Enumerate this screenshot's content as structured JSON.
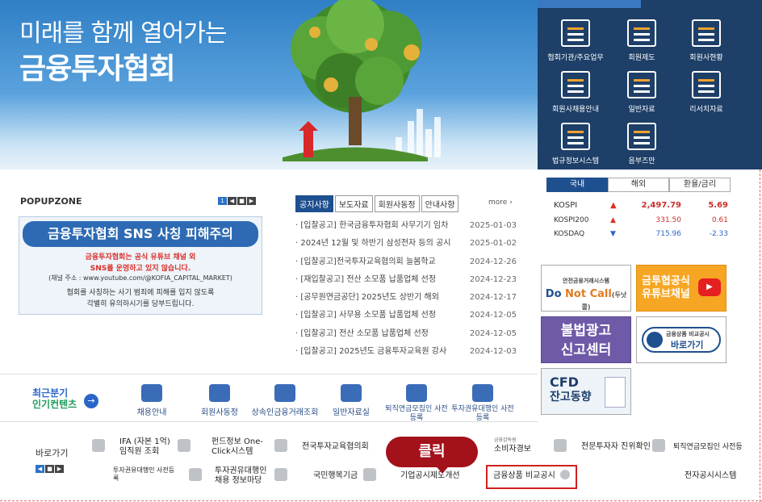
{
  "hero": {
    "subtitle": "미래를 함께 열어가는",
    "title": "금융투자협회"
  },
  "quick_menu": [
    {
      "label": "협회기관/주요업무",
      "icon": "building-icon"
    },
    {
      "label": "회원제도",
      "icon": "magnifier-icon"
    },
    {
      "label": "회원사현황",
      "icon": "basket-icon"
    },
    {
      "label": "회원사채용안내",
      "icon": "coffee-icon"
    },
    {
      "label": "일반자료",
      "icon": "document-icon"
    },
    {
      "label": "리서치자료",
      "icon": "tablet-icon"
    },
    {
      "label": "법규정보시스템",
      "icon": "ie-icon"
    },
    {
      "label": "음부즈만",
      "icon": "calculator-icon"
    }
  ],
  "popup": {
    "label": "POPUPZONE",
    "pager": [
      "1",
      "◀",
      "■",
      "▶"
    ],
    "banner_title": "금융투자협회 SNS 사칭 피해주의",
    "line1": "금융투자협회는 공식 유튜브 채널 외",
    "line2": "SNS를 운영하고 있지 않습니다.",
    "line3": "(채널 주소 : www.youtube.com/@KOFIA_CAPITAL_MARKET)",
    "line4": "협회를 사칭하는 사기 범죄에 피해를 입지 않도록",
    "line5": "각별히 유의하시기를 당부드립니다."
  },
  "notice": {
    "tabs": [
      "공지사항",
      "보도자료",
      "회원사동정",
      "안내사항"
    ],
    "more": "more",
    "items": [
      {
        "title": "[입찰공고] 한국금융투자협회 사무기기 임차",
        "date": "2025-01-03"
      },
      {
        "title": "2024년 12월 및 하반기 삼성전자 등의 공시",
        "date": "2025-01-02"
      },
      {
        "title": "[입찰공고]전국투자교육협의회 늘봄학교",
        "date": "2024-12-26"
      },
      {
        "title": "[재입찰공고] 전산 소모품 납품업체 선정",
        "date": "2024-12-23"
      },
      {
        "title": "[공무원연금공단] 2025년도 상반기 해외",
        "date": "2024-12-17"
      },
      {
        "title": "[입찰공고] 사무용 소모품 납품업체 선정",
        "date": "2024-12-05"
      },
      {
        "title": "[입찰공고] 전산 소모품 납품업체 선정",
        "date": "2024-12-05"
      },
      {
        "title": "[입찰공고] 2025년도 금융투자교육원 강사",
        "date": "2024-12-03"
      }
    ]
  },
  "market": {
    "tabs": [
      "국내",
      "해외",
      "환율/금리"
    ],
    "rows": [
      {
        "name": "KOSPI",
        "arrow": "▲",
        "value": "2,497.79",
        "change": "5.69",
        "dir": "up"
      },
      {
        "name": "KOSPI200",
        "arrow": "▲",
        "value": "331.50",
        "change": "0.61",
        "dir": "up"
      },
      {
        "name": "KOSDAQ",
        "arrow": "▼",
        "value": "715.96",
        "change": "-2.33",
        "dir": "down"
      }
    ]
  },
  "side_banners": {
    "donotcall_small": "안전금융거래시스템",
    "donotcall_a": "Do ",
    "donotcall_b": "Not Call",
    "donotcall_c": "(두낫콜)",
    "youtube1": "금투협공식",
    "youtube2": "유튜브채널",
    "illegal1": "불법광고",
    "illegal2": "신고센터",
    "compare_small": "금융상품 비교공시",
    "compare": "바로가기",
    "cfd1": "CFD",
    "cfd2": "잔고동향"
  },
  "recent": {
    "title1": "최근분기",
    "title2": "인기컨텐츠",
    "arrow": "→",
    "items": [
      "채용안내",
      "회원사동정",
      "상속인금융거래조회",
      "일반자료실",
      "퇴직연금모집인 사전등록",
      "투자권유대행인 사전등록"
    ]
  },
  "quick_links": {
    "label": "바로가기",
    "pager": [
      "◀",
      "■",
      "▶"
    ],
    "row1": [
      "IFA (자본 1억) 임직원 조회",
      "펀드정보 One-Click시스템",
      "전국투자교육협의회",
      "소비자경보",
      "전문투자자 진위확인",
      "퇴직연금모집인 사전등"
    ],
    "row1_small": "금융감독원",
    "row2": [
      "투자권유대행인 사전등록",
      "투자권유대행인 채용 정보마당",
      "국민행복기금",
      "기업공시제도개선",
      "금융상품 비교공시",
      "전자공시시스템"
    ]
  },
  "annotation": {
    "click": "클릭"
  }
}
